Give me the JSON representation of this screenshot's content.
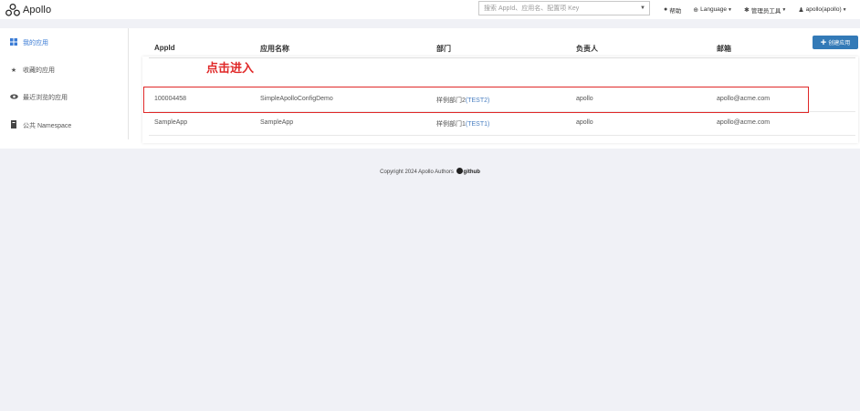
{
  "navbar": {
    "brand": "Apollo",
    "search_placeholder": "搜索 AppId、应用名、配置项 Key",
    "help": "帮助",
    "language": "Language",
    "admin_tools": "管理员工具",
    "user": "apollo(apollo)"
  },
  "sidebar": {
    "items": [
      {
        "label": "我的应用",
        "icon": "grid-icon"
      },
      {
        "label": "收藏的应用",
        "icon": "star-icon"
      },
      {
        "label": "最近浏览的应用",
        "icon": "eye-icon"
      },
      {
        "label": "公共 Namespace",
        "icon": "book-icon"
      }
    ]
  },
  "create_button": "创建应用",
  "annotation": "点击进入",
  "table": {
    "headers": [
      "AppId",
      "应用名称",
      "部门",
      "负责人",
      "邮箱"
    ],
    "rows": [
      {
        "appid": "100004458",
        "name": "SimpleApolloConfigDemo",
        "dept": "样例部门2",
        "dept_code": "(TEST2)",
        "owner": "apollo",
        "email": "apollo@acme.com"
      },
      {
        "appid": "SampleApp",
        "name": "SampleApp",
        "dept": "样例部门1",
        "dept_code": "(TEST1)",
        "owner": "apollo",
        "email": "apollo@acme.com"
      }
    ]
  },
  "footer": {
    "text": "Copyright 2024 Apollo Authors",
    "link": "github"
  },
  "colors": {
    "primary": "#337ab7",
    "annotation": "#e02828",
    "background": "#f0f1f6"
  }
}
